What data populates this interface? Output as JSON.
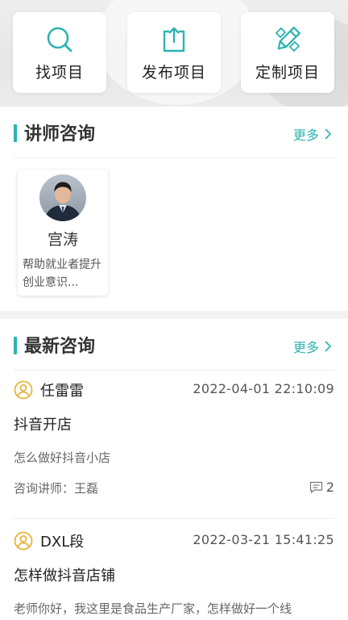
{
  "actions": [
    {
      "label": "找项目",
      "icon": "search-icon"
    },
    {
      "label": "发布项目",
      "icon": "upload-icon"
    },
    {
      "label": "定制项目",
      "icon": "pencil-icon"
    }
  ],
  "accent_color": "#2bb3b1",
  "lecturer_section": {
    "title": "讲师咨询",
    "more": "更多",
    "lecturers": [
      {
        "name": "宫涛",
        "desc": "帮助就业者提升创业意识..."
      }
    ]
  },
  "latest_section": {
    "title": "最新咨询",
    "more": "更多",
    "items": [
      {
        "user": "任雷雷",
        "time": "2022-04-01 22:10:09",
        "title": "抖音开店",
        "body": "怎么做好抖音小店",
        "lecturer_label": "咨询讲师：",
        "lecturer": "王磊",
        "comments": "2"
      },
      {
        "user": "DXL段",
        "time": "2022-03-21 15:41:25",
        "title": "怎样做抖音店铺",
        "body": "老师你好，我这里是食品生产厂家，怎样做好一个线"
      }
    ]
  }
}
